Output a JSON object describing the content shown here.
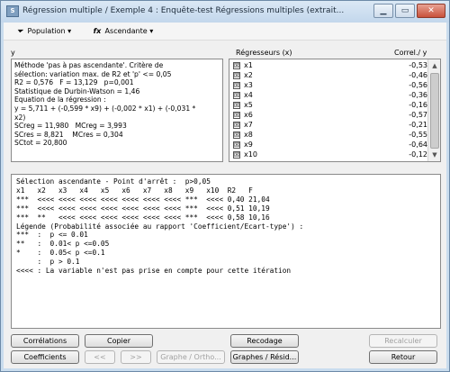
{
  "window": {
    "title": "Régression multiple / Exemple 4 : Enquête-test Régressions multiples (extrait...",
    "icon_text": "S"
  },
  "toolbar": {
    "population_label": "Population",
    "ascendante_label": "Ascendante"
  },
  "left_panel": {
    "header": "y",
    "lines": [
      "Méthode 'pas à pas ascendante'. Critère de",
      "sélection: variation max. de R2 et 'p' <= 0,05",
      "R2 = 0,576   F = 13,129   p=0,001",
      "Statistique de Durbin-Watson = 1,46",
      "Equation de la régression :",
      "y = 5,711 + (-0,599 * x9) + (-0,002 * x1) + (-0,031 *",
      "x2)",
      "",
      "SCreg = 11,980   MCreg = 3,993",
      "SCres = 8,821    MCres = 0,304",
      "SCtot = 20,800"
    ]
  },
  "regressors": {
    "header": "Régresseurs (x)",
    "correl_header": "Correl./ y",
    "items": [
      {
        "name": "x1",
        "value": "-0,53"
      },
      {
        "name": "x2",
        "value": "-0,46"
      },
      {
        "name": "x3",
        "value": "-0,56"
      },
      {
        "name": "x4",
        "value": "-0,36"
      },
      {
        "name": "x5",
        "value": "-0,16"
      },
      {
        "name": "x6",
        "value": "-0,57"
      },
      {
        "name": "x7",
        "value": "-0,21"
      },
      {
        "name": "x8",
        "value": "-0,55"
      },
      {
        "name": "x9",
        "value": "-0,64"
      },
      {
        "name": "x10",
        "value": "-0,12"
      }
    ]
  },
  "output": {
    "lines": [
      "Sélection ascendante - Point d'arrêt :  p>0,05",
      "x1   x2   x3   x4   x5   x6   x7   x8   x9   x10  R2   F",
      "***  <<<< <<<< <<<< <<<< <<<< <<<< <<<< ***  <<<< 0,40 21,04",
      "***  <<<< <<<< <<<< <<<< <<<< <<<< <<<< ***  <<<< 0,51 10,19",
      "***  **   <<<< <<<< <<<< <<<< <<<< <<<< ***  <<<< 0,58 10,16",
      "",
      "Légende (Probabilité associée au rapport 'Coefficient/Ecart-type') :",
      "***  :  p <= 0.01",
      "**   :  0.01< p <=0.05",
      "*    :  0.05< p <=0.1",
      "     :  p > 0.1",
      "<<<< : La variable n'est pas prise en compte pour cette itération"
    ]
  },
  "buttons": {
    "correlations": "Corrélations",
    "copier": "Copier",
    "recodage": "Recodage",
    "recalculer": "Recalculer",
    "coefficients": "Coefficients",
    "prev": "<<",
    "next": ">>",
    "graphe_ortho": "Graphe / Ortho...",
    "graphes_resid": "Graphes / Résid...",
    "retour": "Retour"
  }
}
